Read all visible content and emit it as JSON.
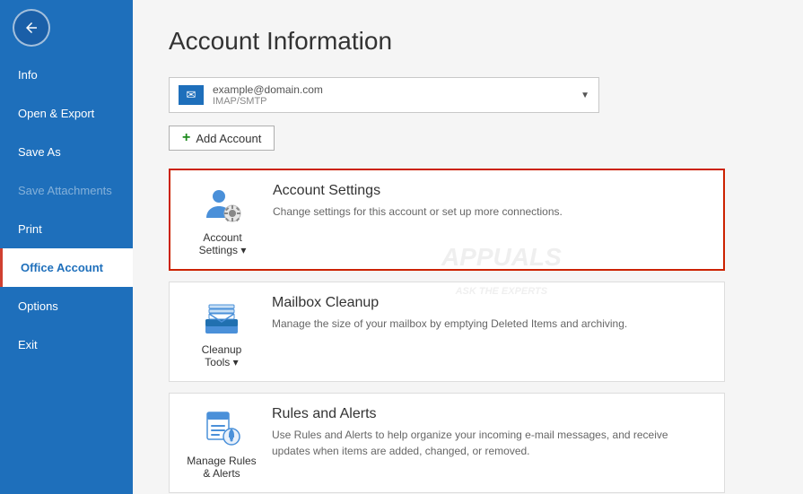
{
  "sidebar": {
    "back_title": "Back",
    "items": [
      {
        "id": "info",
        "label": "Info",
        "active": false,
        "disabled": false
      },
      {
        "id": "open-export",
        "label": "Open & Export",
        "active": false,
        "disabled": false
      },
      {
        "id": "save-as",
        "label": "Save As",
        "active": false,
        "disabled": false
      },
      {
        "id": "save-attachments",
        "label": "Save Attachments",
        "active": false,
        "disabled": true
      },
      {
        "id": "print",
        "label": "Print",
        "active": false,
        "disabled": false
      },
      {
        "id": "office-account",
        "label": "Office Account",
        "active": true,
        "disabled": false
      },
      {
        "id": "options",
        "label": "Options",
        "active": false,
        "disabled": false
      },
      {
        "id": "exit",
        "label": "Exit",
        "active": false,
        "disabled": false
      }
    ]
  },
  "main": {
    "page_title": "Account Information",
    "account": {
      "email": "example@domain.com",
      "type": "IMAP/SMTP",
      "dropdown_arrow": "▼"
    },
    "add_account_label": "Add Account",
    "cards": [
      {
        "id": "account-settings",
        "icon_label": "Account\nSettings ▾",
        "title": "Account Settings",
        "description": "Change settings for this account or set up more connections.",
        "highlighted": true
      },
      {
        "id": "mailbox-cleanup",
        "icon_label": "Cleanup\nTools ▾",
        "title": "Mailbox Cleanup",
        "description": "Manage the size of your mailbox by emptying Deleted Items and archiving.",
        "highlighted": false
      },
      {
        "id": "rules-alerts",
        "icon_label": "Manage Rules\n& Alerts",
        "title": "Rules and Alerts",
        "description": "Use Rules and Alerts to help organize your incoming e-mail messages, and receive updates when items are added, changed, or removed.",
        "highlighted": false
      }
    ]
  }
}
